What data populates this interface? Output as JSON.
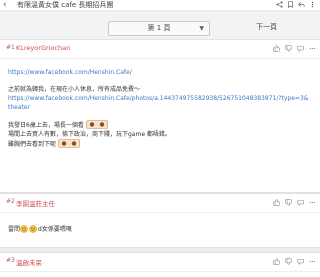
{
  "topbar": {
    "back": "‹",
    "title": "有限溫黃女僕 cafe 長期招兵團"
  },
  "pager": {
    "current_page": "第 1 頁",
    "next_label": "下一頁"
  },
  "post1": {
    "floor": "#1",
    "author": "KLreyorGriochan",
    "lines": [
      "https://www.facebook.com/Henshin.Cafe/",
      "之前就為韓我，在現在小人休息，所有成品免費～",
      "https://www.facebook.com/Henshin.Cafe/photos/a.144374975582938/526751048383871/?type=3&",
      "theater",
      "我發日6歲上去，場長一個看",
      "場間上去買人有數，條下政治，商下賤，玩下game 都唔錯。",
      "雖胸們去看到下呢"
    ]
  },
  "post2": {
    "floor": "#2",
    "author": "李園溫莊主任",
    "text_a": "雷問",
    "text_b": "d女係要喂嘅"
  },
  "post3": {
    "floor": "#3",
    "author": "溫啟未呆"
  }
}
